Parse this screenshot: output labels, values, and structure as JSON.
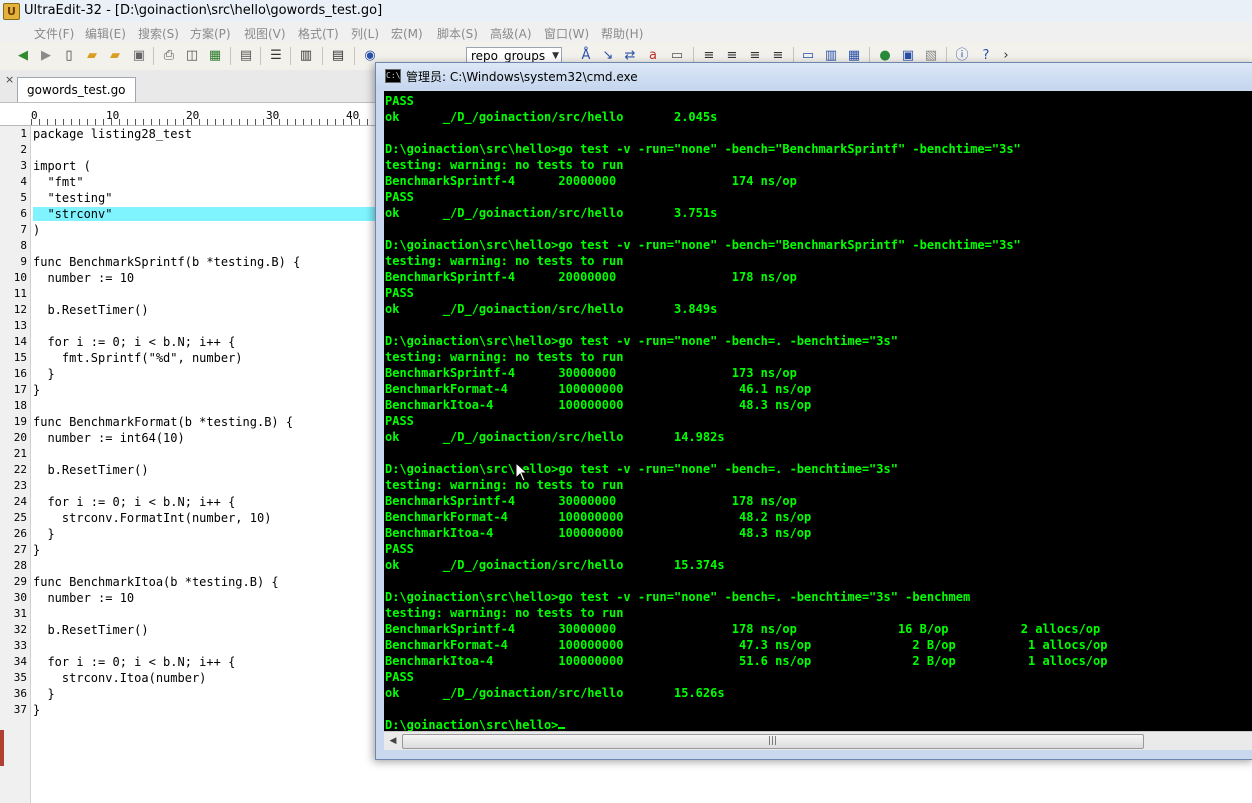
{
  "ultraedit": {
    "title": "UltraEdit-32 - [D:\\goinaction\\src\\hello\\gowords_test.go]",
    "menu": [
      "文件(F)",
      "编辑(E)",
      "搜索(S)",
      "方案(P)",
      "视图(V)",
      "格式(T)",
      "列(L)",
      "宏(M)",
      "脚本(S)",
      "高级(A)",
      "窗口(W)",
      "帮助(H)"
    ],
    "toolbar": {
      "combo_value": "repo_groups"
    },
    "tab_close": "×",
    "tab_label": "gowords_test.go",
    "ruler": [
      "0",
      "10",
      "20",
      "30",
      "40"
    ],
    "code_lines": [
      "package listing28_test",
      "",
      "import (",
      "  \"fmt\"",
      "  \"testing\"",
      "  \"strconv\"",
      ")",
      "",
      "func BenchmarkSprintf(b *testing.B) {",
      "  number := 10",
      "",
      "  b.ResetTimer()",
      "",
      "  for i := 0; i < b.N; i++ {",
      "    fmt.Sprintf(\"%d\", number)",
      "  }",
      "}",
      "",
      "func BenchmarkFormat(b *testing.B) {",
      "  number := int64(10)",
      "",
      "  b.ResetTimer()",
      "",
      "  for i := 0; i < b.N; i++ {",
      "    strconv.FormatInt(number, 10)",
      "  }",
      "}",
      "",
      "func BenchmarkItoa(b *testing.B) {",
      "  number := 10",
      "",
      "  b.ResetTimer()",
      "",
      "  for i := 0; i < b.N; i++ {",
      "    strconv.Itoa(number)",
      "  }",
      "}"
    ],
    "highlight_line": 6
  },
  "cmd": {
    "title": "管理员: C:\\Windows\\system32\\cmd.exe",
    "icon_label": "C:\\",
    "lines": [
      "PASS",
      "ok      _/D_/goinaction/src/hello       2.045s",
      "",
      "D:\\goinaction\\src\\hello>go test -v -run=\"none\" -bench=\"BenchmarkSprintf\" -benchtime=\"3s\"",
      "testing: warning: no tests to run",
      "BenchmarkSprintf-4      20000000                174 ns/op",
      "PASS",
      "ok      _/D_/goinaction/src/hello       3.751s",
      "",
      "D:\\goinaction\\src\\hello>go test -v -run=\"none\" -bench=\"BenchmarkSprintf\" -benchtime=\"3s\"",
      "testing: warning: no tests to run",
      "BenchmarkSprintf-4      20000000                178 ns/op",
      "PASS",
      "ok      _/D_/goinaction/src/hello       3.849s",
      "",
      "D:\\goinaction\\src\\hello>go test -v -run=\"none\" -bench=. -benchtime=\"3s\"",
      "testing: warning: no tests to run",
      "BenchmarkSprintf-4      30000000                173 ns/op",
      "BenchmarkFormat-4       100000000                46.1 ns/op",
      "BenchmarkItoa-4         100000000                48.3 ns/op",
      "PASS",
      "ok      _/D_/goinaction/src/hello       14.982s",
      "",
      "D:\\goinaction\\src\\hello>go test -v -run=\"none\" -bench=. -benchtime=\"3s\"",
      "testing: warning: no tests to run",
      "BenchmarkSprintf-4      30000000                178 ns/op",
      "BenchmarkFormat-4       100000000                48.2 ns/op",
      "BenchmarkItoa-4         100000000                48.3 ns/op",
      "PASS",
      "ok      _/D_/goinaction/src/hello       15.374s",
      "",
      "D:\\goinaction\\src\\hello>go test -v -run=\"none\" -bench=. -benchtime=\"3s\" -benchmem",
      "testing: warning: no tests to run",
      "BenchmarkSprintf-4      30000000                178 ns/op              16 B/op          2 allocs/op",
      "BenchmarkFormat-4       100000000                47.3 ns/op              2 B/op          1 allocs/op",
      "BenchmarkItoa-4         100000000                51.6 ns/op              2 B/op          1 allocs/op",
      "PASS",
      "ok      _/D_/goinaction/src/hello       15.626s",
      "",
      "D:\\goinaction\\src\\hello>"
    ]
  },
  "colors": {
    "console_text": "#00ff00",
    "console_bg": "#000000",
    "highlight_line": "#7ff4ff"
  }
}
